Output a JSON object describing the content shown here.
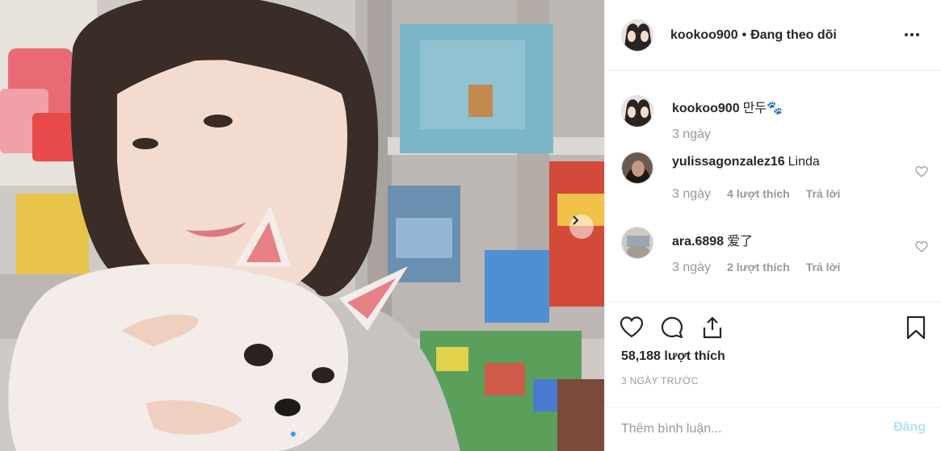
{
  "post": {
    "username": "kookoo900",
    "separator": "•",
    "follow_label": "Đang theo dõi",
    "more_icon": "more-horizontal-icon",
    "likes_text": "58,188 lượt thích",
    "time_ago": "3 NGÀY TRƯỚC"
  },
  "caption": {
    "username": "kookoo900",
    "text": "만두🐾",
    "age": "3 ngày"
  },
  "comments": [
    {
      "username": "yulissagonzalez16",
      "text": "Linda",
      "age": "3 ngày",
      "likes": "4 lượt thích",
      "reply": "Trả lời"
    },
    {
      "username": "ara.6898",
      "text": "爱了",
      "age": "3 ngày",
      "likes": "2 lượt thích",
      "reply": "Trả lời"
    }
  ],
  "actions": {
    "like_icon": "heart-icon",
    "comment_icon": "comment-bubble-icon",
    "share_icon": "share-icon",
    "save_icon": "bookmark-icon"
  },
  "add_comment": {
    "placeholder": "Thêm bình luận...",
    "post_label": "Đăng"
  },
  "carousel": {
    "slide_count": 2,
    "active_index": 0,
    "next_icon": "chevron-right-icon"
  },
  "colors": {
    "text": "#262626",
    "muted": "#999999",
    "divider": "#efefef",
    "post_button_disabled": "#b2dffc",
    "carousel_active_dot": "#3897f0"
  }
}
